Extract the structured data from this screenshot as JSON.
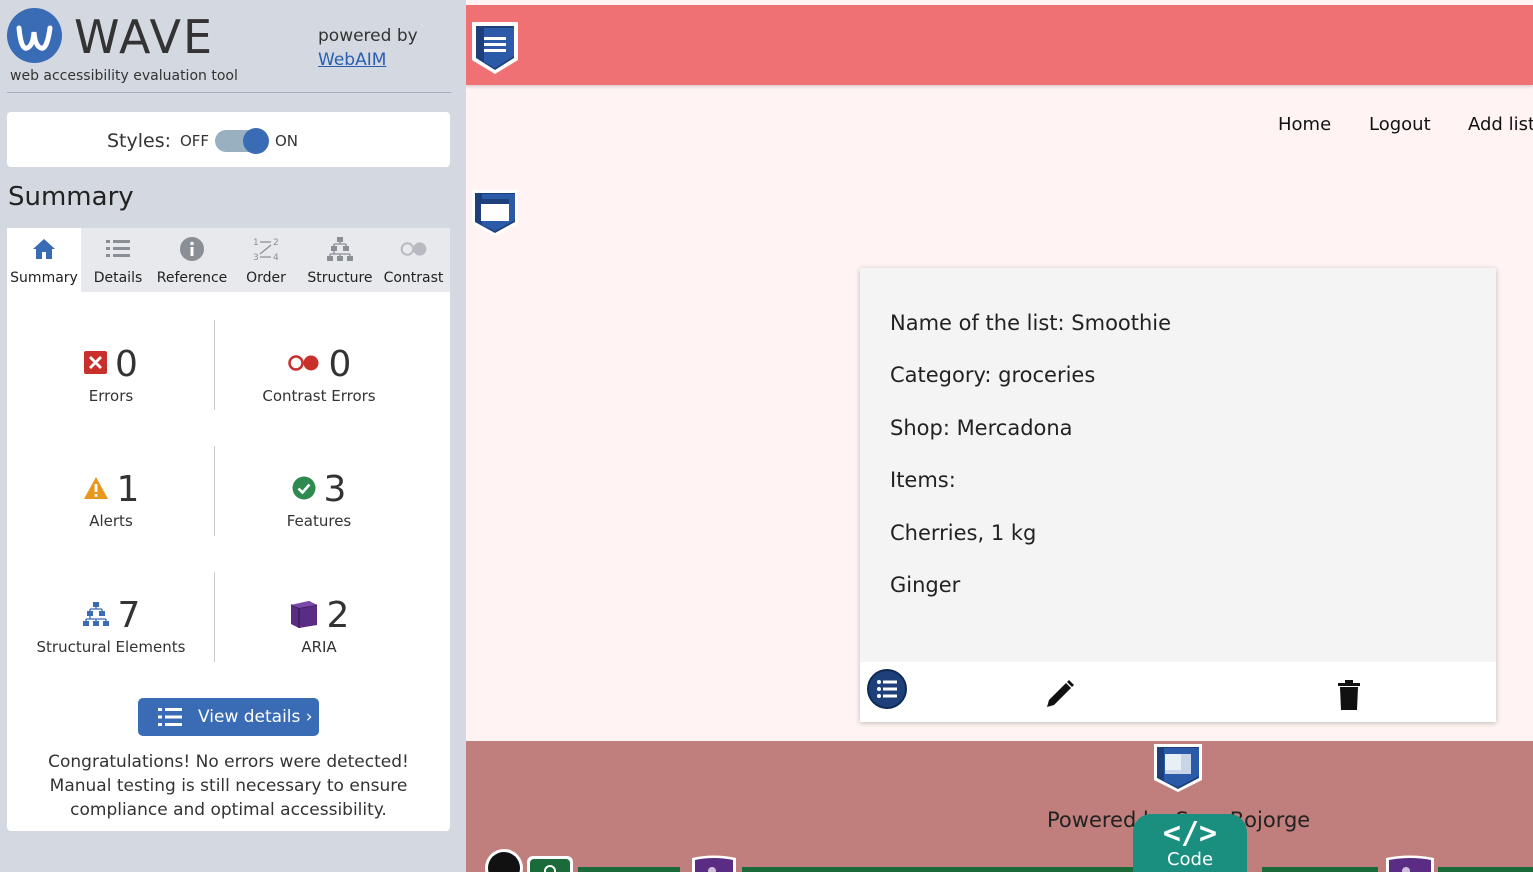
{
  "wave": {
    "title": "WAVE",
    "subtitle": "web accessibility evaluation tool",
    "powered_by": "powered by",
    "webaim_link": "WebAIM",
    "styles": {
      "label": "Styles:",
      "off": "OFF",
      "on": "ON",
      "state": "on"
    },
    "summary_heading": "Summary",
    "tabs": [
      {
        "label": "Summary",
        "icon": "home-icon",
        "active": true
      },
      {
        "label": "Details",
        "icon": "list-icon"
      },
      {
        "label": "Reference",
        "icon": "info-icon"
      },
      {
        "label": "Order",
        "icon": "order-icon"
      },
      {
        "label": "Structure",
        "icon": "structure-icon"
      },
      {
        "label": "Contrast",
        "icon": "contrast-icon"
      }
    ],
    "stats": {
      "errors": {
        "count": "0",
        "label": "Errors",
        "icon": "error-x-icon",
        "color": "#c9302c"
      },
      "contrast_errors": {
        "count": "0",
        "label": "Contrast Errors",
        "icon": "contrast-error-icon",
        "color": "#c9302c"
      },
      "alerts": {
        "count": "1",
        "label": "Alerts",
        "icon": "alert-triangle-icon",
        "color": "#e8961c"
      },
      "features": {
        "count": "3",
        "label": "Features",
        "icon": "check-circle-icon",
        "color": "#2f8a4f"
      },
      "structural": {
        "count": "7",
        "label": "Structural Elements",
        "icon": "structure-icon",
        "color": "#3a6bb5"
      },
      "aria": {
        "count": "2",
        "label": "ARIA",
        "icon": "aria-cube-icon",
        "color": "#5b2c83"
      }
    },
    "view_details": "View details ›",
    "congrats": "Congratulations! No errors were detected! Manual testing is still necessary to ensure compliance and optimal accessibility."
  },
  "page": {
    "nav": [
      "Home",
      "Logout",
      "Add list"
    ],
    "card": {
      "lines": [
        "Name of the list: Smoothie",
        "Category: groceries",
        "Shop: Mercadona",
        "Items:",
        "Cherries, 1 kg",
        "Ginger"
      ],
      "actions": [
        "list-icon",
        "pencil-icon",
        "trash-icon"
      ]
    },
    "footer_text": "Powered by Sara Bojorge",
    "code_button": {
      "icon": "</>",
      "label": "Code"
    },
    "colors": {
      "topbar": "#f07174",
      "background": "#fff4f3",
      "footer": "#c07f7d",
      "wave_accent": "#3a6bb5"
    }
  }
}
